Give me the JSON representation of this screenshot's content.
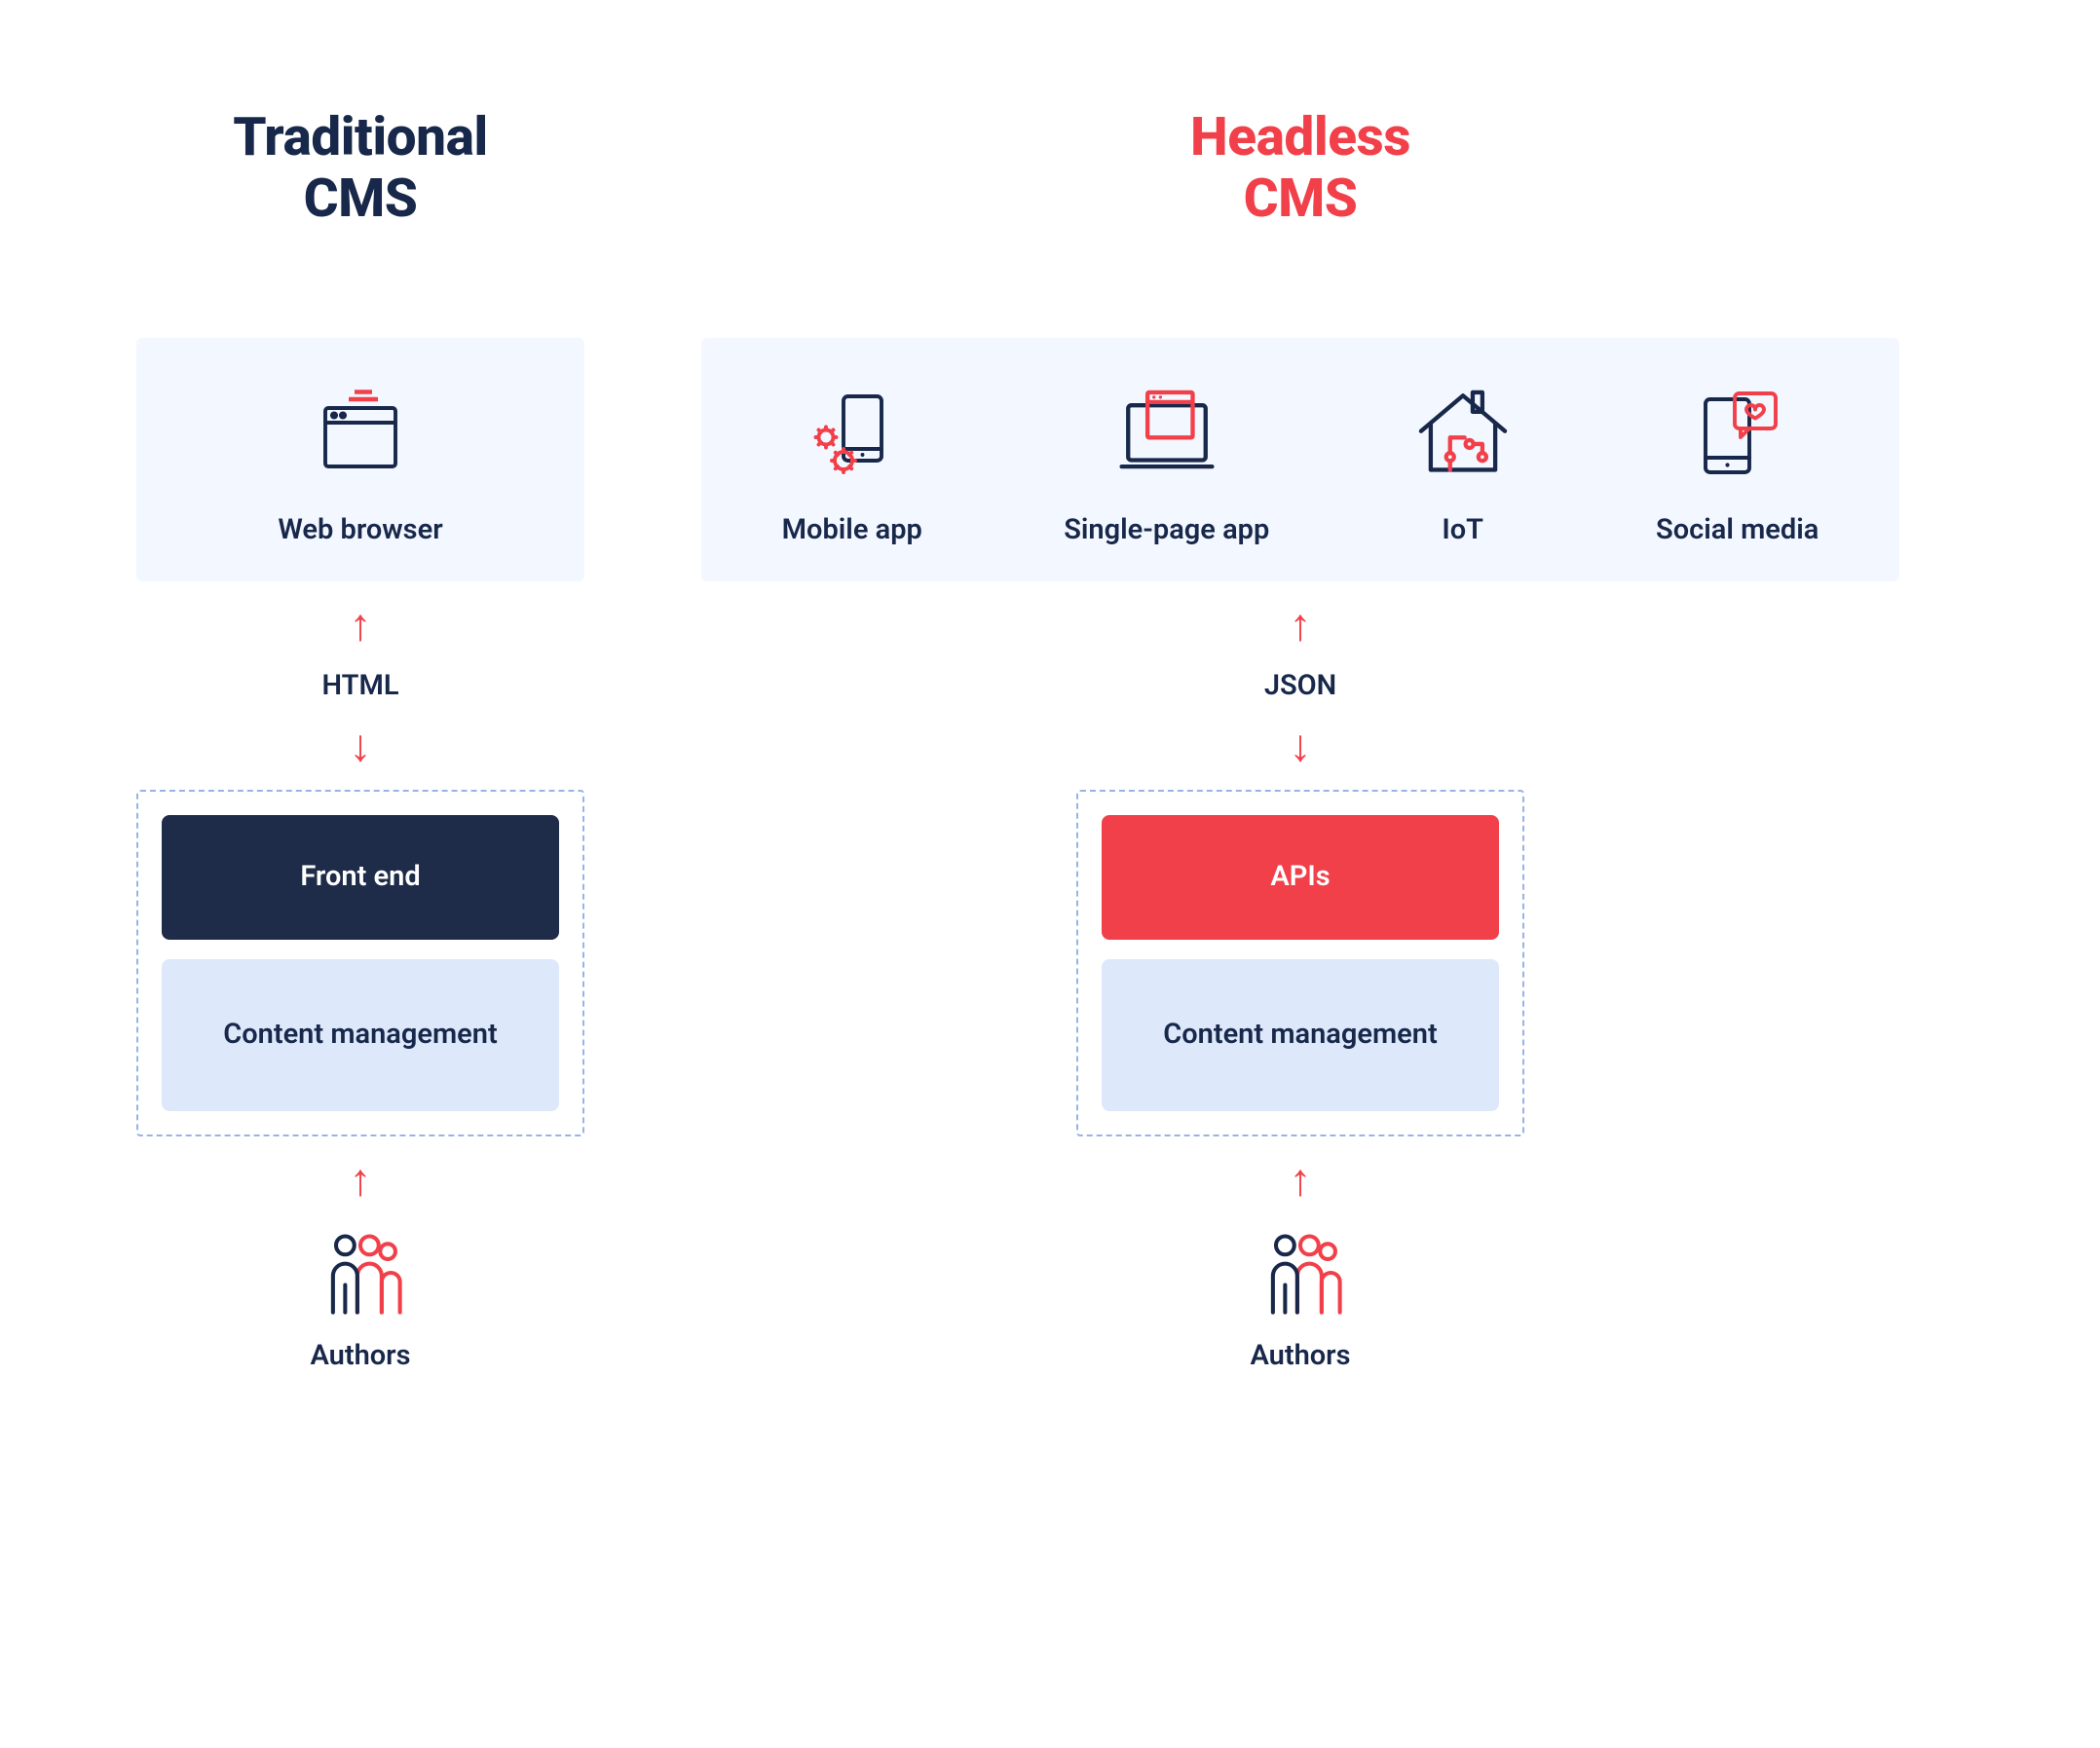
{
  "colors": {
    "dark": "#18284a",
    "red": "#f2404a",
    "panel_bg": "#f3f7ff",
    "cm_bg": "#dde8fb",
    "dashed_border": "#98b4e6"
  },
  "traditional": {
    "title_line1": "Traditional",
    "title_line2": "CMS",
    "consumer": {
      "label": "Web browser",
      "icon": "browser-icon"
    },
    "format_label": "HTML",
    "layers": {
      "front": "Front end",
      "cm": "Content management"
    },
    "authors_label": "Authors"
  },
  "headless": {
    "title_line1": "Headless",
    "title_line2": "CMS",
    "consumers": [
      {
        "label": "Mobile app",
        "icon": "mobile-app-icon"
      },
      {
        "label": "Single-page app",
        "icon": "spa-icon"
      },
      {
        "label": "IoT",
        "icon": "iot-icon"
      },
      {
        "label": "Social media",
        "icon": "social-media-icon"
      }
    ],
    "format_label": "JSON",
    "layers": {
      "apis": "APIs",
      "cm": "Content management"
    },
    "authors_label": "Authors"
  }
}
